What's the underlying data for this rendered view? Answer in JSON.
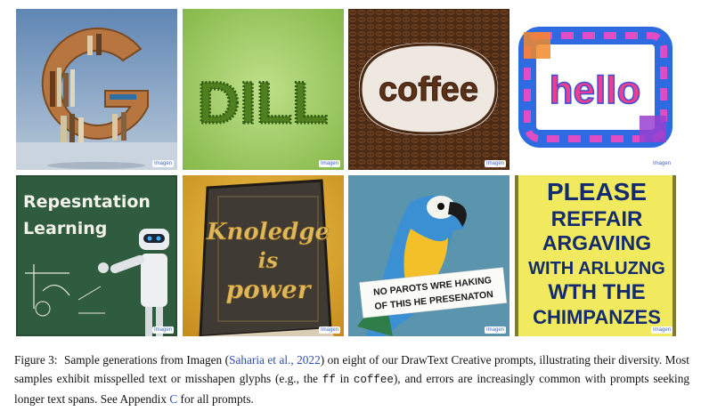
{
  "tiles": [
    {
      "id": "g-bookshelf",
      "watermark": "Imagen"
    },
    {
      "id": "dill-grass",
      "text": "DILL",
      "watermark": "Imagen"
    },
    {
      "id": "coffee-beans",
      "text": "coffee",
      "watermark": "Imagen"
    },
    {
      "id": "hello-fur",
      "text": "hello",
      "watermark": "Imagen"
    },
    {
      "id": "chalkboard-robot",
      "line1": "Repesntation",
      "line2": "Learning",
      "watermark": "Imagen"
    },
    {
      "id": "knoledge-book",
      "line1": "Knoledge",
      "line2": "is",
      "line3": "power",
      "watermark": "Imagen"
    },
    {
      "id": "parrot-sign",
      "line1": "NO PAROTS WRE HAKING",
      "line2": "OF THIS HE PRESENATON",
      "watermark": "Imagen"
    },
    {
      "id": "protest-sign",
      "line1": "PLEASE",
      "line2": "REFFAIR",
      "line3": "ARGAVING",
      "line4": "WITH ARLUZNG",
      "line5": "WTH THE",
      "line6": "CHIMPANZES",
      "watermark": "Imagen"
    }
  ],
  "caption": {
    "label": "Figure 3:",
    "text1": "Sample generations from Imagen (",
    "cite": "Saharia et al., 2022",
    "text2": ") on eight of our DrawText Creative prompts, illustrating their diversity. Most samples exhibit misspelled text or misshapen glyphs (e.g., the ",
    "code1": "ff",
    "text3": " in ",
    "code2": "coffee",
    "text4": "), and errors are increasingly common with prompts seeking longer text spans. See Appendix ",
    "appendix": "C",
    "text5": " for all prompts."
  }
}
